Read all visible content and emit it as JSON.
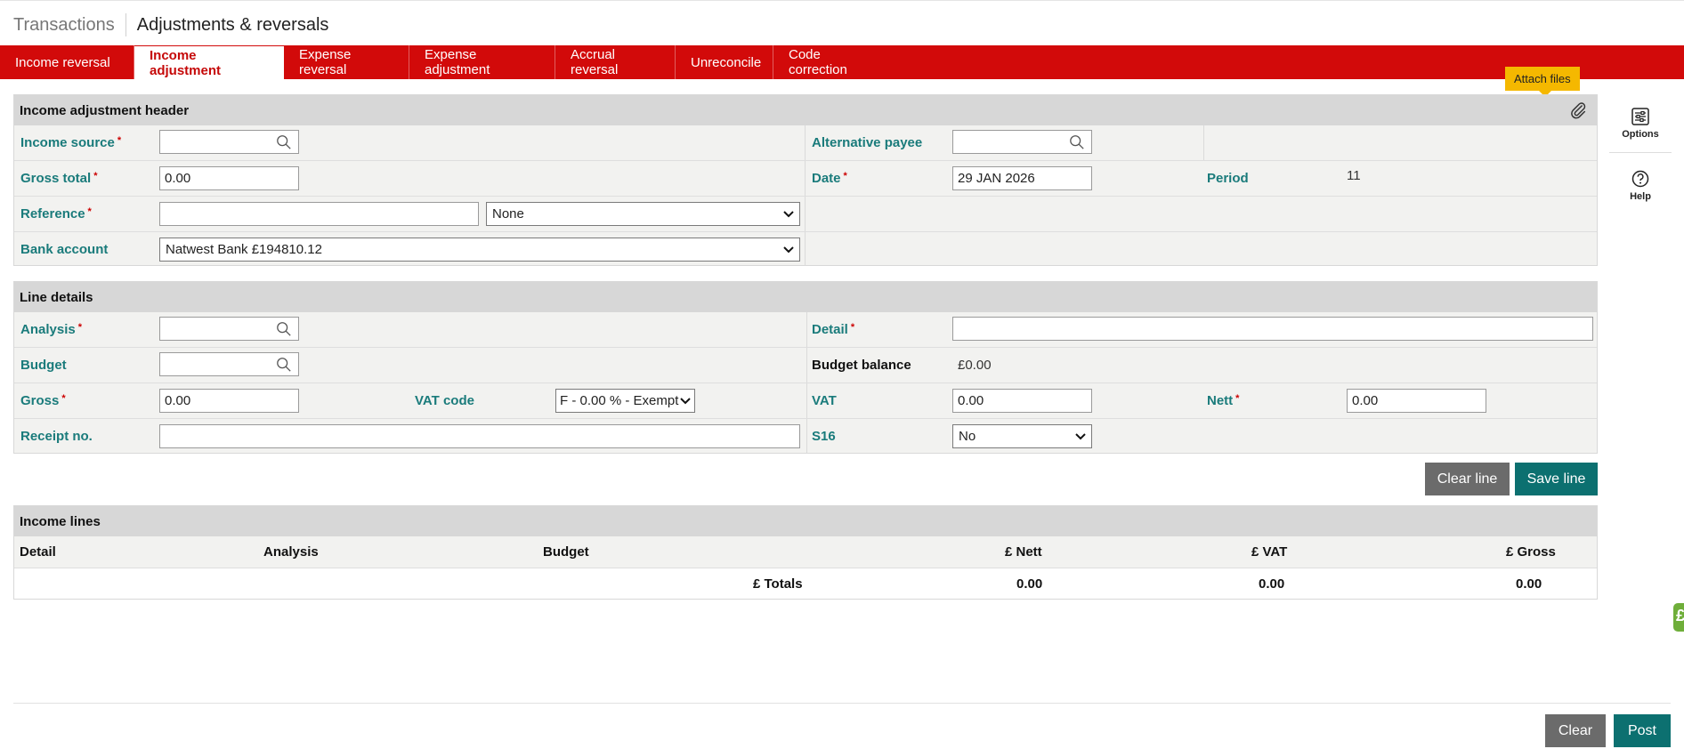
{
  "breadcrumb": {
    "parent": "Transactions",
    "current": "Adjustments & reversals"
  },
  "tabs": [
    {
      "label": "Income reversal"
    },
    {
      "label": "Income adjustment",
      "active": true
    },
    {
      "label": "Expense reversal"
    },
    {
      "label": "Expense adjustment"
    },
    {
      "label": "Accrual reversal"
    },
    {
      "label": "Unreconcile"
    },
    {
      "label": "Code correction"
    }
  ],
  "tooltip": "Attach files",
  "header": {
    "title": "Income adjustment header",
    "income_source_label": "Income source",
    "alternative_payee_label": "Alternative payee",
    "gross_total_label": "Gross total",
    "gross_total_value": "0.00",
    "date_label": "Date",
    "date_value": "29 JAN 2026",
    "period_label": "Period",
    "period_value": "11",
    "reference_label": "Reference",
    "reference_value": "",
    "reference_type": "None",
    "bank_account_label": "Bank account",
    "bank_account_value": "Natwest Bank £194810.12"
  },
  "line_details": {
    "title": "Line details",
    "analysis_label": "Analysis",
    "detail_label": "Detail",
    "budget_label": "Budget",
    "budget_balance_label": "Budget balance",
    "budget_balance_value": "£0.00",
    "gross_label": "Gross",
    "gross_value": "0.00",
    "vat_code_label": "VAT code",
    "vat_code_value": "F - 0.00 % - Exempt",
    "vat_label": "VAT",
    "vat_value": "0.00",
    "nett_label": "Nett",
    "nett_value": "0.00",
    "receipt_label": "Receipt no.",
    "s16_label": "S16",
    "s16_value": "No",
    "clear_line": "Clear line",
    "save_line": "Save line"
  },
  "income_lines": {
    "title": "Income lines",
    "columns": [
      "Detail",
      "Analysis",
      "Budget",
      "£ Nett",
      "£ VAT",
      "£ Gross"
    ],
    "totals_label": "£ Totals",
    "totals": {
      "nett": "0.00",
      "vat": "0.00",
      "gross": "0.00"
    }
  },
  "sidebar": {
    "options": "Options",
    "help": "Help"
  },
  "footer": {
    "clear": "Clear",
    "post": "Post"
  },
  "edge_badge": "£",
  "colors": {
    "brand_red": "#d20a0a",
    "teal": "#0c7070",
    "label_teal": "#1a7b7b",
    "tooltip": "#f5b800"
  },
  "icons": [
    "search-icon",
    "paperclip-icon",
    "chevron-down-icon",
    "options-icon",
    "help-icon"
  ]
}
